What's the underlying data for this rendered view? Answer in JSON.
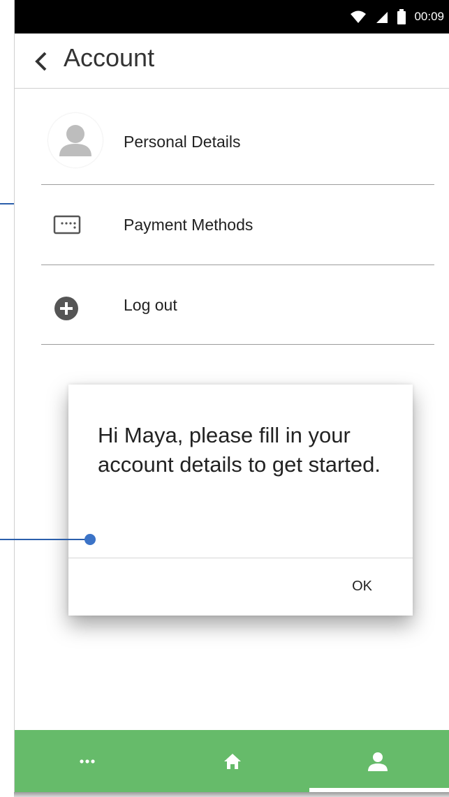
{
  "status_bar": {
    "time": "00:09"
  },
  "header": {
    "title": "Account"
  },
  "menu": [
    {
      "label": "Personal Details",
      "icon": "person-avatar-icon"
    },
    {
      "label": "Payment Methods",
      "icon": "card-icon"
    },
    {
      "label": "Log out",
      "icon": "plus-circle-icon"
    }
  ],
  "dialog": {
    "message": "Hi Maya, please fill in your account details to get started.",
    "ok_label": "OK"
  },
  "bottom_nav": {
    "tabs": [
      {
        "name": "more",
        "icon": "more-dots-icon"
      },
      {
        "name": "home",
        "icon": "home-icon"
      },
      {
        "name": "account",
        "icon": "person-icon",
        "selected": true
      }
    ],
    "color": "#66bb6a"
  },
  "colors": {
    "annotation": "#3b73c7"
  }
}
